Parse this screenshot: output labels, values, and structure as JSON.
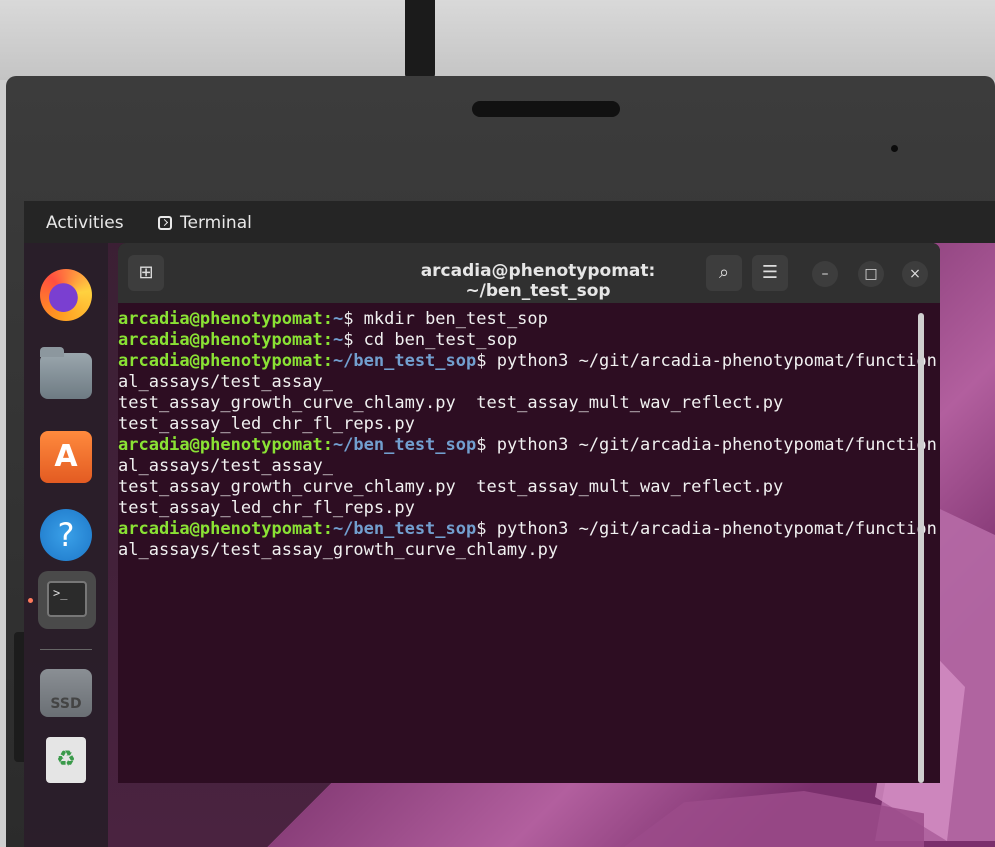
{
  "topbar": {
    "activities": "Activities",
    "app_name": "Terminal"
  },
  "dock": {
    "store_glyph": "A",
    "help_glyph": "?",
    "ssd_label": "SSD",
    "trash_glyph": "♻"
  },
  "window": {
    "title": "arcadia@phenotypomat: ~/ben_test_sop"
  },
  "terminal": {
    "user_host": "arcadia@phenotypomat",
    "lines": [
      {
        "user": "arcadia@phenotypomat",
        "path": "~",
        "cmd": "$ mkdir ben_test_sop"
      },
      {
        "user": "arcadia@phenotypomat",
        "path": "~",
        "cmd": "$ cd ben_test_sop"
      },
      {
        "user": "arcadia@phenotypomat",
        "path": "~/ben_test_sop",
        "cmd": "$ python3 ~/git/arcadia-phenotypomat/function"
      },
      {
        "text": "al_assays/test_assay_"
      },
      {
        "text": "test_assay_growth_curve_chlamy.py  test_assay_mult_wav_reflect.py"
      },
      {
        "text": "test_assay_led_chr_fl_reps.py"
      },
      {
        "user": "arcadia@phenotypomat",
        "path": "~/ben_test_sop",
        "cmd": "$ python3 ~/git/arcadia-phenotypomat/function"
      },
      {
        "text": "al_assays/test_assay_"
      },
      {
        "text": "test_assay_growth_curve_chlamy.py  test_assay_mult_wav_reflect.py"
      },
      {
        "text": "test_assay_led_chr_fl_reps.py"
      },
      {
        "user": "arcadia@phenotypomat",
        "path": "~/ben_test_sop",
        "cmd": "$ python3 ~/git/arcadia-phenotypomat/function"
      },
      {
        "text": "al_assays/test_assay_growth_curve_chlamy.py"
      }
    ]
  },
  "colors": {
    "user": "#8ae234",
    "path": "#729fcf",
    "terminal_bg": "#2d0d22"
  }
}
